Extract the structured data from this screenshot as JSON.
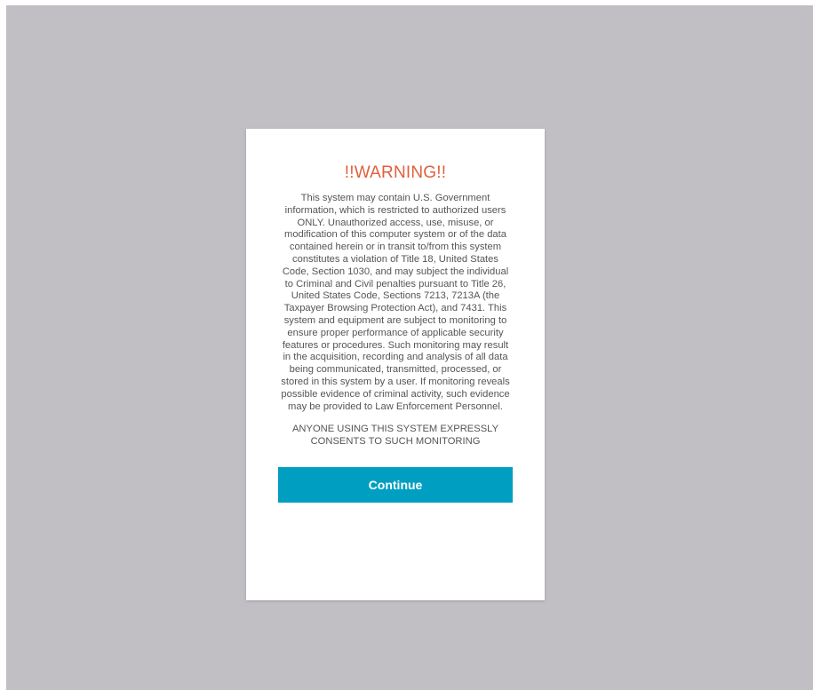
{
  "dialog": {
    "title": "!!WARNING!!",
    "body": "This system may contain U.S. Government information, which is restricted to authorized users ONLY. Unauthorized access, use, misuse, or modification of this computer system or of the data contained herein or in transit to/from this system constitutes a violation of Title 18, United States Code, Section 1030, and may subject the individual to Criminal and Civil penalties pursuant to Title 26, United States Code, Sections 7213, 7213A (the Taxpayer Browsing Protection Act), and 7431. This system and equipment are subject to monitoring to ensure proper performance of applicable security features or procedures. Such monitoring may result in the acquisition, recording and analysis of all data being communicated, transmitted, processed, or stored in this system by a user. If monitoring reveals possible evidence of criminal activity, such evidence may be provided to Law Enforcement Personnel.",
    "consent": "ANYONE USING THIS SYSTEM EXPRESSLY CONSENTS TO SUCH MONITORING",
    "continue_label": "Continue"
  },
  "colors": {
    "backdrop": "#c2bfc4",
    "title": "#e0603e",
    "button": "#009fc2"
  }
}
